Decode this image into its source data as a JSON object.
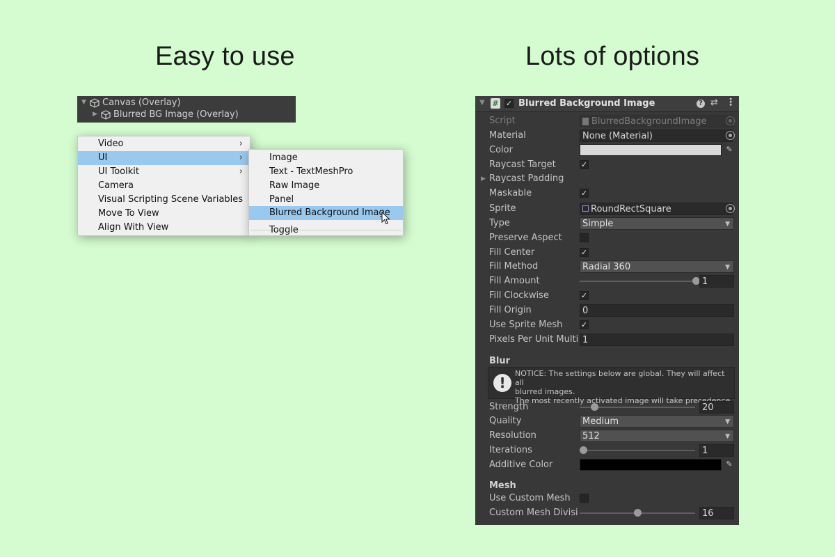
{
  "headings": {
    "left": "Easy to use",
    "right": "Lots of options"
  },
  "hierarchy": {
    "root": "Canvas (Overlay)",
    "child": "Blurred BG Image (Overlay)"
  },
  "menu": {
    "items": [
      {
        "label": "Video",
        "has_sub": true
      },
      {
        "label": "UI",
        "has_sub": true,
        "selected": true
      },
      {
        "label": "UI Toolkit",
        "has_sub": true
      },
      {
        "label": "Camera"
      },
      {
        "label": "Visual Scripting Scene Variables"
      },
      {
        "label": "Move To View"
      },
      {
        "label": "Align With View"
      }
    ],
    "sub_items": [
      "Image",
      "Text - TextMeshPro",
      "Raw Image",
      "Panel",
      "Blurred Background Image",
      "Toggle"
    ],
    "sub_selected": "Blurred Background Image"
  },
  "inspector": {
    "title": "Blurred Background Image",
    "script": {
      "label": "Script",
      "value": "BlurredBackgroundImage"
    },
    "material": {
      "label": "Material",
      "value": "None (Material)"
    },
    "color": {
      "label": "Color",
      "value": "#d9d9d9"
    },
    "raycast_target": {
      "label": "Raycast Target",
      "checked": true
    },
    "raycast_padding": {
      "label": "Raycast Padding"
    },
    "maskable": {
      "label": "Maskable",
      "checked": true
    },
    "sprite": {
      "label": "Sprite",
      "value": "RoundRectSquare"
    },
    "type": {
      "label": "Type",
      "value": "Simple"
    },
    "preserve_aspect": {
      "label": "Preserve Aspect",
      "checked": false
    },
    "fill_center": {
      "label": "Fill Center",
      "checked": true
    },
    "fill_method": {
      "label": "Fill Method",
      "value": "Radial 360"
    },
    "fill_amount": {
      "label": "Fill Amount",
      "value": "1",
      "fraction": 1.0
    },
    "fill_clockwise": {
      "label": "Fill Clockwise",
      "checked": true
    },
    "fill_origin": {
      "label": "Fill Origin",
      "value": "0"
    },
    "use_sprite_mesh": {
      "label": "Use Sprite Mesh",
      "checked": true
    },
    "pixels_per_unit": {
      "label": "Pixels Per Unit Multip",
      "value": "1"
    },
    "blur_section": "Blur",
    "notice": {
      "line1": "NOTICE: The settings below are global. They will affect all",
      "line2": "blurred images.",
      "line3": "The most recently activated image will take precedence."
    },
    "strength": {
      "label": "Strength",
      "value": "20",
      "fraction": 0.1
    },
    "quality": {
      "label": "Quality",
      "value": "Medium"
    },
    "resolution": {
      "label": "Resolution",
      "value": "512"
    },
    "iterations": {
      "label": "Iterations",
      "value": "1",
      "fraction": 0.0
    },
    "additive_color": {
      "label": "Additive Color",
      "value": "#000000"
    },
    "mesh_section": "Mesh",
    "use_custom_mesh": {
      "label": "Use Custom Mesh",
      "checked": false
    },
    "custom_mesh_divisions": {
      "label": "Custom Mesh Divisio",
      "value": "16",
      "fraction": 0.48
    }
  }
}
